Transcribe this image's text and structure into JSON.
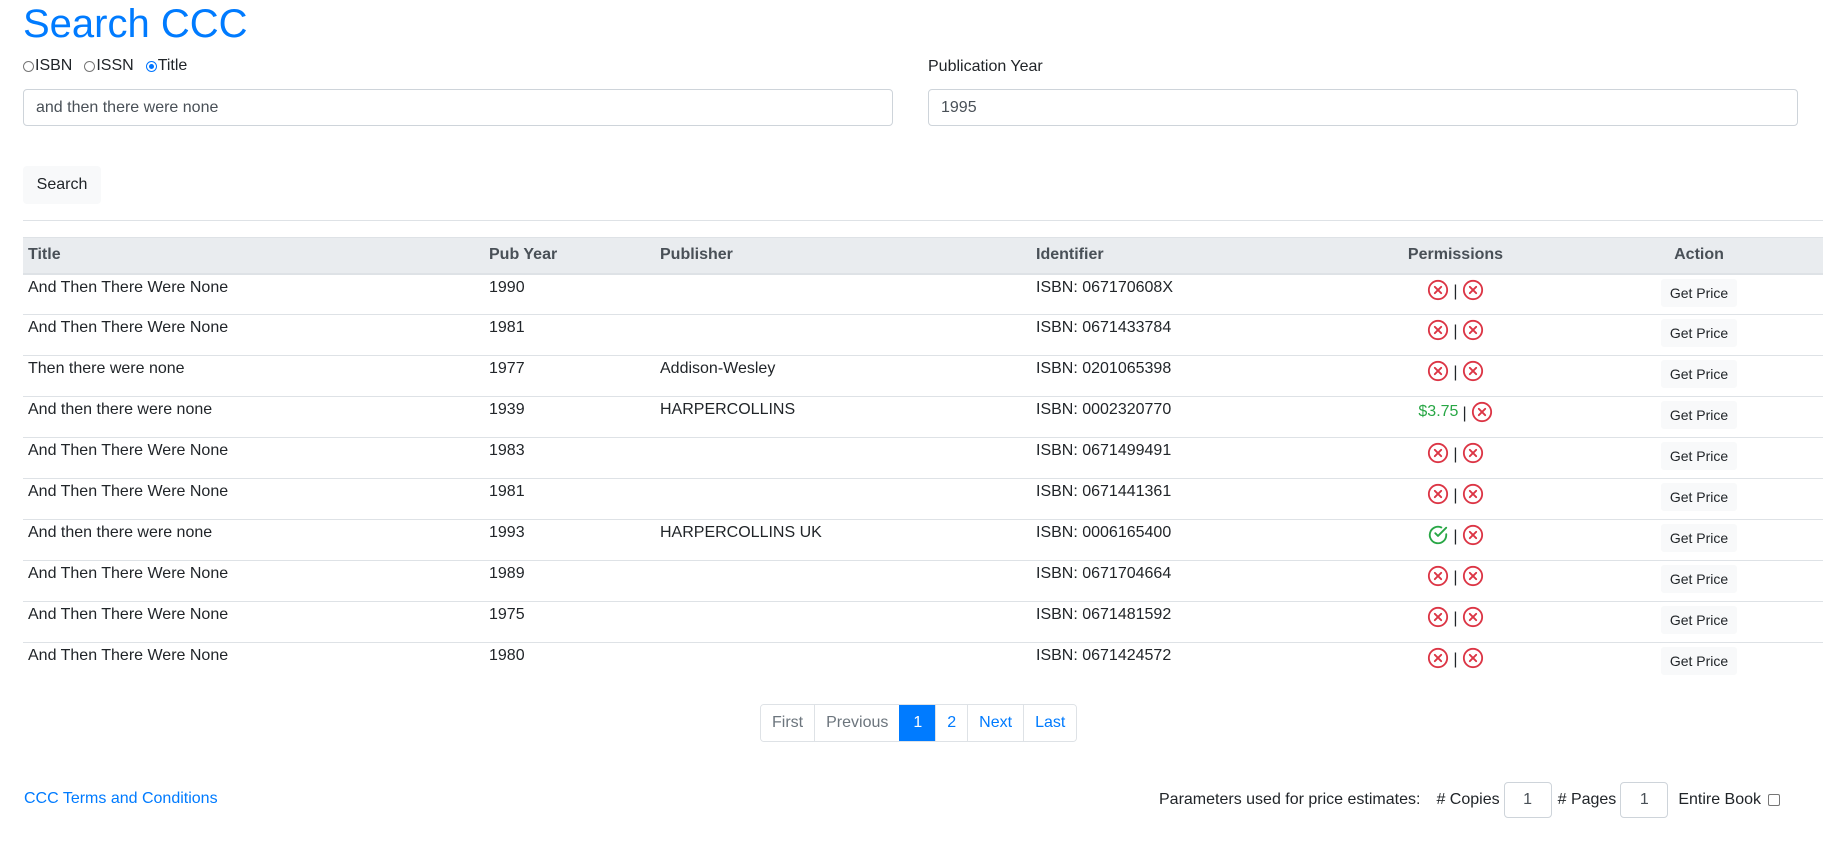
{
  "header": {
    "title": "Search CCC"
  },
  "search": {
    "radios": [
      {
        "label": "ISBN",
        "checked": false
      },
      {
        "label": "ISSN",
        "checked": false
      },
      {
        "label": "Title",
        "checked": true
      }
    ],
    "query_value": "and then there were none",
    "year_label": "Publication Year",
    "year_value": "1995",
    "search_button": "Search"
  },
  "table": {
    "headers": [
      "Title",
      "Pub Year",
      "Publisher",
      "Identifier",
      "Permissions",
      "Action"
    ],
    "rows": [
      {
        "title": "And Then There Were None",
        "year": "1990",
        "publisher": "",
        "identifier": "ISBN: 067170608X",
        "perm1": "x",
        "perm2": "x",
        "action": "Get Price"
      },
      {
        "title": "And Then There Were None",
        "year": "1981",
        "publisher": "",
        "identifier": "ISBN: 0671433784",
        "perm1": "x",
        "perm2": "x",
        "action": "Get Price"
      },
      {
        "title": "Then there were none",
        "year": "1977",
        "publisher": "Addison-Wesley",
        "identifier": "ISBN: 0201065398",
        "perm1": "x",
        "perm2": "x",
        "action": "Get Price"
      },
      {
        "title": "And then there were none",
        "year": "1939",
        "publisher": "HARPERCOLLINS",
        "identifier": "ISBN: 0002320770",
        "perm1": "$3.75",
        "perm2": "x",
        "action": "Get Price"
      },
      {
        "title": "And Then There Were None",
        "year": "1983",
        "publisher": "",
        "identifier": "ISBN: 0671499491",
        "perm1": "x",
        "perm2": "x",
        "action": "Get Price"
      },
      {
        "title": "And Then There Were None",
        "year": "1981",
        "publisher": "",
        "identifier": "ISBN: 0671441361",
        "perm1": "x",
        "perm2": "x",
        "action": "Get Price"
      },
      {
        "title": "And then there were none",
        "year": "1993",
        "publisher": "HARPERCOLLINS UK",
        "identifier": "ISBN: 0006165400",
        "perm1": "check",
        "perm2": "x",
        "action": "Get Price"
      },
      {
        "title": "And Then There Were None",
        "year": "1989",
        "publisher": "",
        "identifier": "ISBN: 0671704664",
        "perm1": "x",
        "perm2": "x",
        "action": "Get Price"
      },
      {
        "title": "And Then There Were None",
        "year": "1975",
        "publisher": "",
        "identifier": "ISBN: 0671481592",
        "perm1": "x",
        "perm2": "x",
        "action": "Get Price"
      },
      {
        "title": "And Then There Were None",
        "year": "1980",
        "publisher": "",
        "identifier": "ISBN: 0671424572",
        "perm1": "x",
        "perm2": "x",
        "action": "Get Price"
      }
    ],
    "separator": "|"
  },
  "pagination": {
    "items": [
      {
        "label": "First",
        "state": "disabled"
      },
      {
        "label": "Previous",
        "state": "disabled"
      },
      {
        "label": "1",
        "state": "active"
      },
      {
        "label": "2",
        "state": "normal"
      },
      {
        "label": "Next",
        "state": "normal"
      },
      {
        "label": "Last",
        "state": "normal"
      }
    ]
  },
  "footer": {
    "terms_link": "CCC Terms and Conditions",
    "params_label": "Parameters used for price estimates:",
    "copies_label": "# Copies",
    "copies_value": "1",
    "pages_label": "# Pages",
    "pages_value": "1",
    "entire_book_label": "Entire Book"
  },
  "colors": {
    "accent": "#007bff",
    "deny": "#dc3545",
    "allow": "#28a745"
  },
  "icons": {
    "deny": "x-circle-icon",
    "allow": "check-circle-icon"
  }
}
